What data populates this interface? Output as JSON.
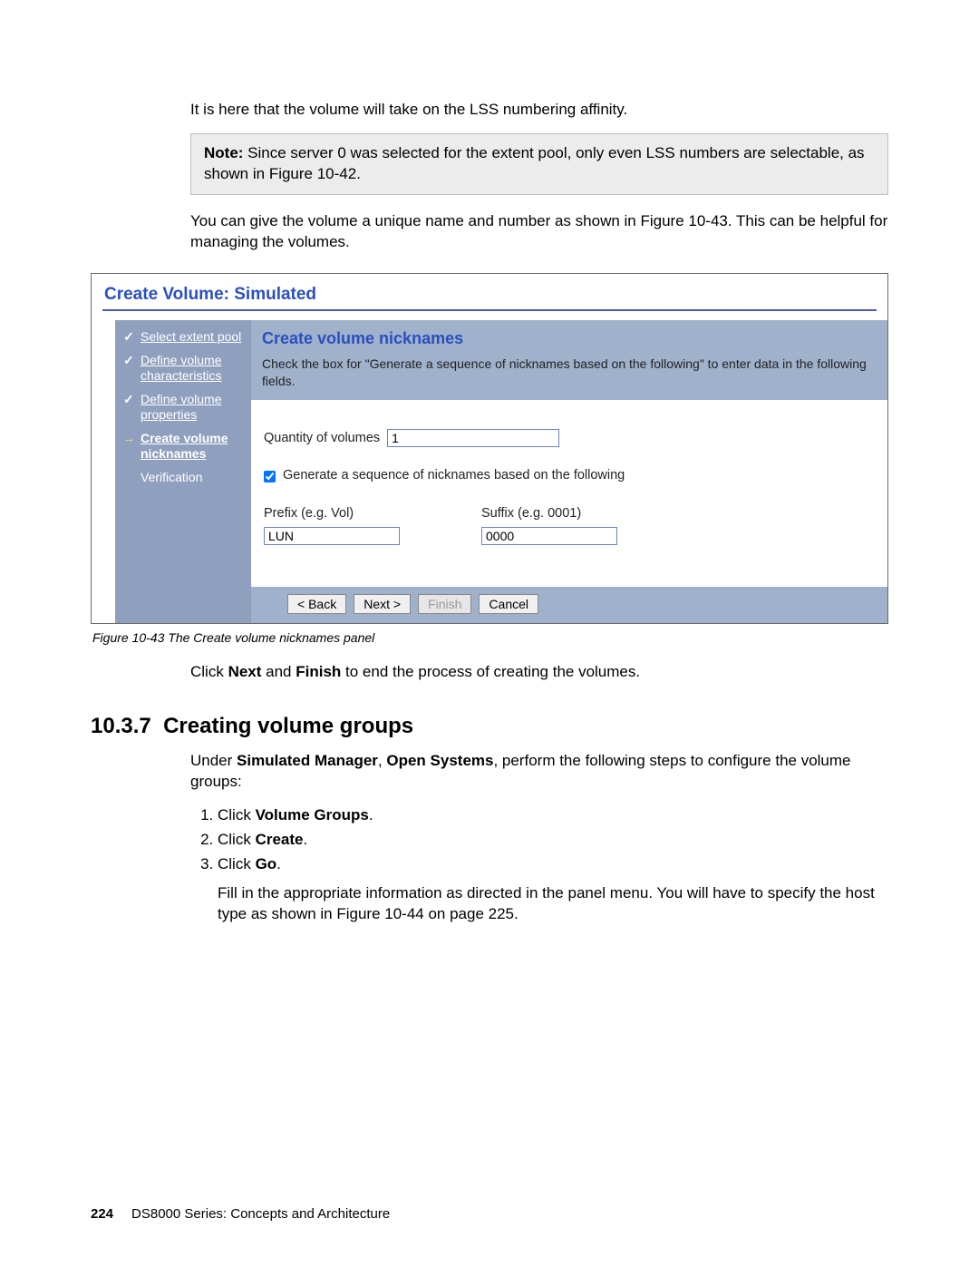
{
  "intro": "It is here that the volume will take on the LSS numbering affinity.",
  "note": {
    "label": "Note:",
    "text": " Since server 0 was selected for the extent pool, only even LSS numbers are selectable, as shown in Figure 10-42."
  },
  "para2": "You can give the volume a unique name and number as shown in Figure 10-43. This can be helpful for managing the volumes.",
  "wizard": {
    "title": "Create Volume: Simulated",
    "steps": [
      {
        "mark": "✓",
        "label": "Select extent pool",
        "done": true
      },
      {
        "mark": "✓",
        "label": "Define volume characteristics",
        "done": true
      },
      {
        "mark": "✓",
        "label": "Define volume properties",
        "done": true
      },
      {
        "mark": "→",
        "label": "Create volume nicknames",
        "current": true
      },
      {
        "mark": "",
        "label": "Verification",
        "plain": true
      }
    ],
    "panel": {
      "heading": "Create volume nicknames",
      "desc": "Check the box for \"Generate a sequence of nicknames based on the following\" to enter data in the following fields.",
      "qty_label": "Quantity of volumes",
      "qty_value": "1",
      "checkbox_label": "Generate a sequence of nicknames based on the following",
      "checkbox_checked": true,
      "prefix_label": "Prefix (e.g. Vol)",
      "prefix_value": "LUN",
      "suffix_label": "Suffix (e.g. 0001)",
      "suffix_value": "0000"
    },
    "buttons": {
      "back": "< Back",
      "next": "Next >",
      "finish": "Finish",
      "cancel": "Cancel"
    }
  },
  "figcaption": "Figure 10-43   The Create volume nicknames panel",
  "after_fig": {
    "pre": "Click ",
    "b1": "Next",
    "mid": " and ",
    "b2": "Finish",
    "post": " to end the process of creating the volumes."
  },
  "section": {
    "num": "10.3.7",
    "title": "Creating volume groups",
    "lead_pre": "Under ",
    "lead_b1": "Simulated Manager",
    "lead_mid1": ", ",
    "lead_b2": "Open Systems",
    "lead_post": ", perform the following steps to configure the volume groups:",
    "steps": [
      {
        "pre": "Click ",
        "b": "Volume Groups",
        "post": "."
      },
      {
        "pre": "Click ",
        "b": "Create",
        "post": "."
      },
      {
        "pre": "Click ",
        "b": "Go",
        "post": "."
      }
    ],
    "tail": "Fill in the appropriate information as directed in the panel menu. You will have to specify the host type as shown in Figure 10-44 on page 225."
  },
  "footer": {
    "page": "224",
    "title": "DS8000 Series: Concepts and Architecture"
  }
}
